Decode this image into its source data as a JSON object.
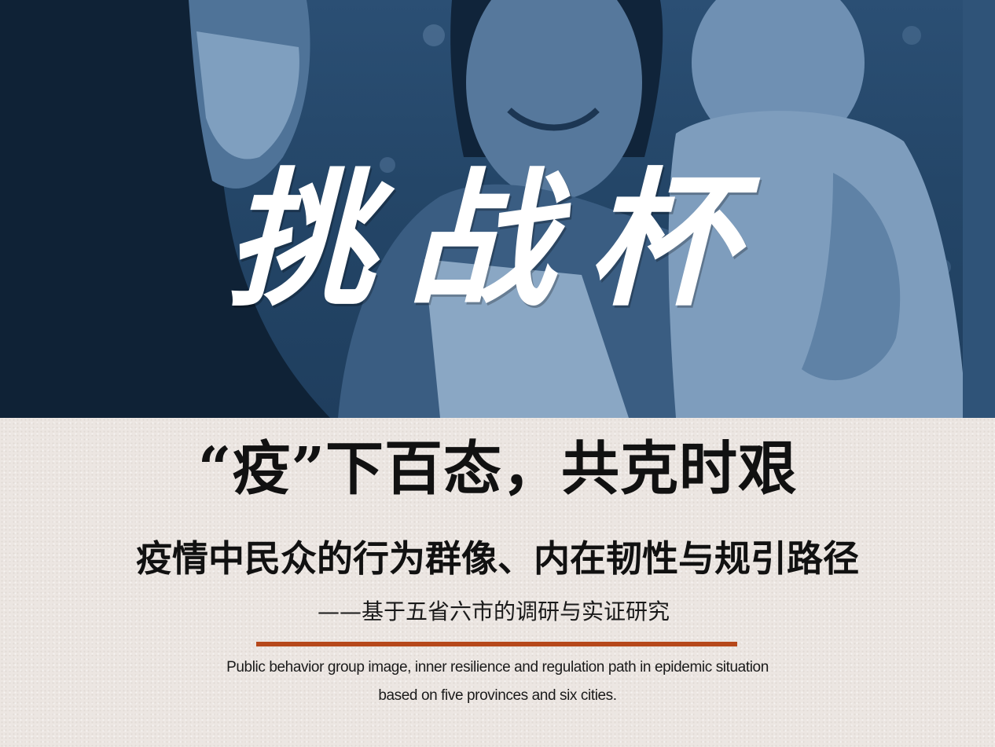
{
  "hero": {
    "calligraphy_title": "挑战杯",
    "tint_color": "#244668"
  },
  "main": {
    "title": "“疫”下百态，共克时艰",
    "subtitle": "疫情中民众的行为群像、内在韧性与规引路径",
    "sub_subtitle": "——基于五省六市的调研与实证研究",
    "accent_rule_color": "#b6481b",
    "english_line_1": "Public behavior group image, inner resilience and regulation path in epidemic situation",
    "english_line_2": "based on five provinces and six cities."
  }
}
